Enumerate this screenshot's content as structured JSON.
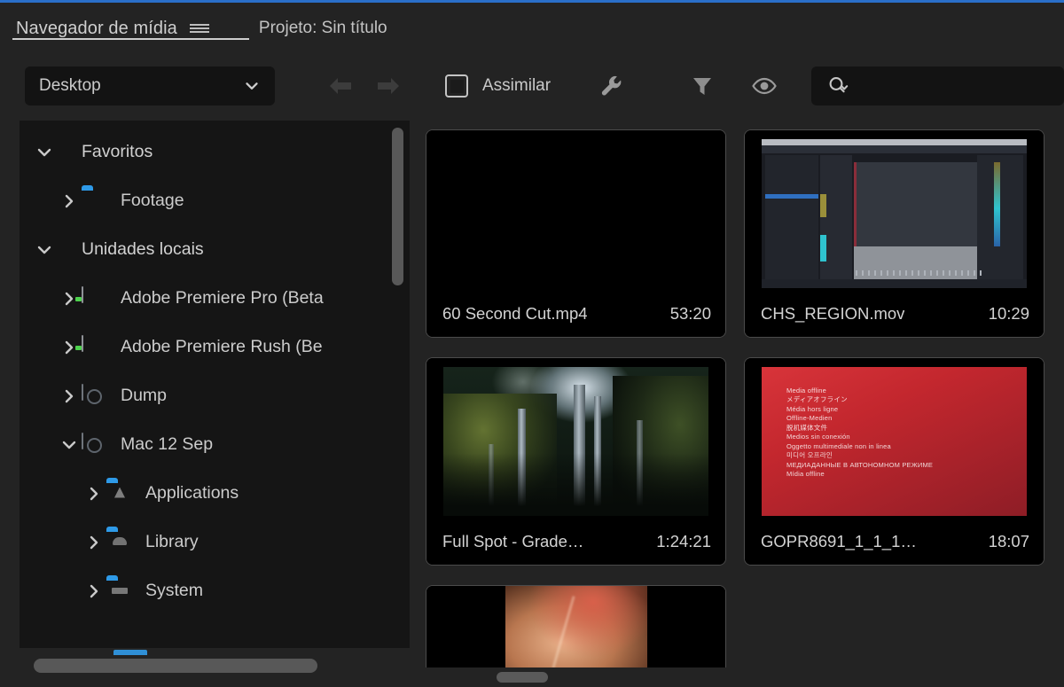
{
  "window": {
    "focus_accent": "#2a6fc9",
    "panel_bg": "#232323",
    "tree_bg": "#151515"
  },
  "panel": {
    "tab_label": "Navegador de mídia",
    "menu_icon": "hamburger-menu-icon",
    "project_label": "Projeto: Sin título"
  },
  "toolbar": {
    "path_value": "Desktop",
    "path_chevron_icon": "chevron-down-icon",
    "back_icon": "arrow-left-icon",
    "forward_icon": "arrow-right-icon",
    "ingest_label": "Assimilar",
    "ingest_checkbox_icon": "checkbox-icon",
    "ingest_checked": false,
    "wrench_icon": "wrench-icon",
    "filter_icon": "funnel-filter-icon",
    "eye_icon": "eye-icon",
    "search_icon": "search-magnifier-icon",
    "search_value": "",
    "search_placeholder": ""
  },
  "tree": {
    "items": [
      {
        "label": "Favoritos",
        "indent": 0,
        "twisty": "down",
        "icon": "none",
        "expanded": true
      },
      {
        "label": "Footage",
        "indent": 1,
        "twisty": "right",
        "icon": "folder-blue",
        "expanded": false
      },
      {
        "label": "Unidades locais",
        "indent": 0,
        "twisty": "down",
        "icon": "none",
        "expanded": true
      },
      {
        "label": "Adobe Premiere Pro (Beta",
        "indent": 1,
        "twisty": "right",
        "icon": "disk-image",
        "expanded": false
      },
      {
        "label": "Adobe Premiere Rush (Be",
        "indent": 1,
        "twisty": "right",
        "icon": "disk-image",
        "expanded": false
      },
      {
        "label": "Dump",
        "indent": 1,
        "twisty": "right",
        "icon": "hard-drive",
        "expanded": false
      },
      {
        "label": "Mac 12 Sep",
        "indent": 1,
        "twisty": "down",
        "icon": "hard-drive",
        "expanded": true
      },
      {
        "label": "Applications",
        "indent": 2,
        "twisty": "right",
        "icon": "folder-app",
        "expanded": false
      },
      {
        "label": "Library",
        "indent": 2,
        "twisty": "right",
        "icon": "folder-lib",
        "expanded": false
      },
      {
        "label": "System",
        "indent": 2,
        "twisty": "right",
        "icon": "folder-sys",
        "expanded": false
      }
    ]
  },
  "media": {
    "items": [
      {
        "name": "60 Second Cut.mp4",
        "duration": "53:20",
        "thumb": "black"
      },
      {
        "name": "CHS_REGION.mov",
        "duration": "10:29",
        "thumb": "screen-recording"
      },
      {
        "name": "Full Spot - Grade…",
        "duration": "1:24:21",
        "thumb": "forest"
      },
      {
        "name": "GOPR8691_1_1_1…",
        "duration": "18:07",
        "thumb": "media-offline"
      }
    ],
    "offline_lines": [
      "Media offline",
      "メディアオフライン",
      "Média hors ligne",
      "Offline-Medien",
      "脱机媒体文件",
      "Medios sin conexión",
      "Oggetto multimediale non in linea",
      "미디어 오프라인",
      "МЕДИАДАННЫЕ В АВТОНОМНОМ РЕЖИМЕ",
      "Mídia offline"
    ]
  }
}
